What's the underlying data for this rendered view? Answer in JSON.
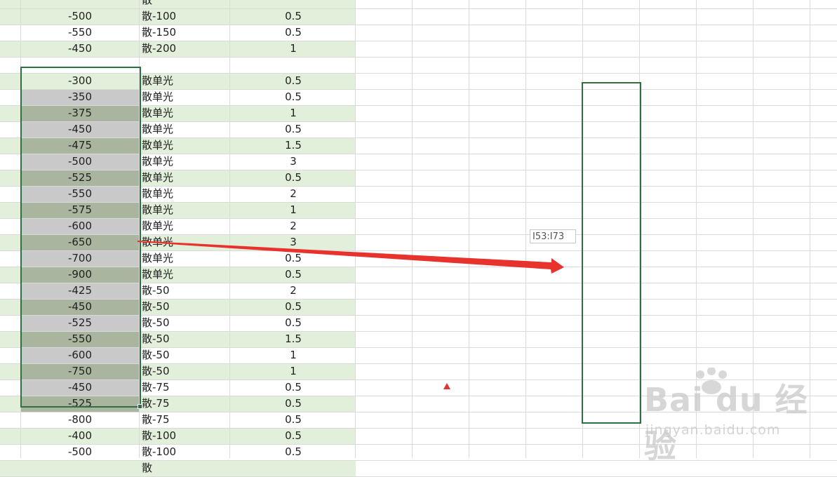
{
  "accent_color": "#2e7044",
  "band_color": "#e2efda",
  "selection_colors": [
    "#c9c9c9",
    "#a9b59f"
  ],
  "annotation_color": "#e8322e",
  "rows": [
    {
      "a": "",
      "b": "散",
      "c": "",
      "band": true,
      "partial": true
    },
    {
      "a": "-500",
      "b": "散-100",
      "c": "0.5",
      "band": true
    },
    {
      "a": "-550",
      "b": "散-150",
      "c": "0.5",
      "band": false
    },
    {
      "a": "-450",
      "b": "散-200",
      "c": "1",
      "band": true
    },
    {
      "a": "",
      "b": "",
      "c": "",
      "band": false
    },
    {
      "a": "-300",
      "b": "散单光",
      "c": "0.5",
      "band": true,
      "sel": "top"
    },
    {
      "a": "-350",
      "b": "散单光",
      "c": "0.5",
      "band": false,
      "sel": "gray"
    },
    {
      "a": "-375",
      "b": "散单光",
      "c": "1",
      "band": true,
      "sel": "green"
    },
    {
      "a": "-450",
      "b": "散单光",
      "c": "0.5",
      "band": false,
      "sel": "gray"
    },
    {
      "a": "-475",
      "b": "散单光",
      "c": "1.5",
      "band": true,
      "sel": "green"
    },
    {
      "a": "-500",
      "b": "散单光",
      "c": "3",
      "band": false,
      "sel": "gray"
    },
    {
      "a": "-525",
      "b": "散单光",
      "c": "0.5",
      "band": true,
      "sel": "green"
    },
    {
      "a": "-550",
      "b": "散单光",
      "c": "2",
      "band": false,
      "sel": "gray"
    },
    {
      "a": "-575",
      "b": "散单光",
      "c": "1",
      "band": true,
      "sel": "green"
    },
    {
      "a": "-600",
      "b": "散单光",
      "c": "2",
      "band": false,
      "sel": "gray"
    },
    {
      "a": "-650",
      "b": "散单光",
      "c": "3",
      "band": true,
      "sel": "green"
    },
    {
      "a": "-700",
      "b": "散单光",
      "c": "0.5",
      "band": false,
      "sel": "gray"
    },
    {
      "a": "-900",
      "b": "散单光",
      "c": "0.5",
      "band": true,
      "sel": "green"
    },
    {
      "a": "-425",
      "b": "散-50",
      "c": "2",
      "band": false,
      "sel": "gray"
    },
    {
      "a": "-450",
      "b": "散-50",
      "c": "0.5",
      "band": true,
      "sel": "green"
    },
    {
      "a": "-525",
      "b": "散-50",
      "c": "0.5",
      "band": false,
      "sel": "gray"
    },
    {
      "a": "-550",
      "b": "散-50",
      "c": "1.5",
      "band": true,
      "sel": "green"
    },
    {
      "a": "-600",
      "b": "散-50",
      "c": "1",
      "band": false,
      "sel": "gray"
    },
    {
      "a": "-750",
      "b": "散-50",
      "c": "1",
      "band": true,
      "sel": "green"
    },
    {
      "a": "-450",
      "b": "散-75",
      "c": "0.5",
      "band": false,
      "sel": "gray"
    },
    {
      "a": "-525",
      "b": "散-75",
      "c": "0.5",
      "band": true,
      "sel": "green"
    },
    {
      "a": "-800",
      "b": "散-75",
      "c": "0.5",
      "band": false
    },
    {
      "a": "-400",
      "b": "散-100",
      "c": "0.5",
      "band": true
    },
    {
      "a": "-500",
      "b": "散-100",
      "c": "0.5",
      "band": false
    },
    {
      "a": "",
      "b": "散",
      "c": "",
      "band": true,
      "partial": true
    }
  ],
  "range_tooltip": "I53:I73",
  "watermark": {
    "logo": "Bai du 经验",
    "url": "jingyan.baidu.com"
  }
}
